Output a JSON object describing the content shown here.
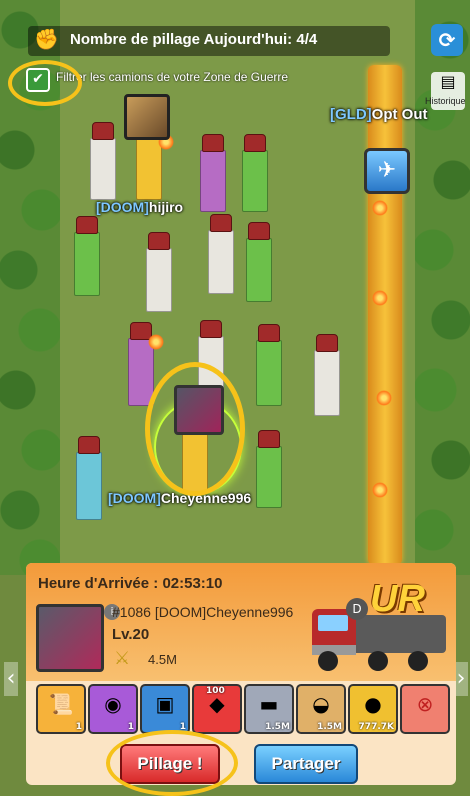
{
  "header": {
    "raid_count_label": "Nombre de pillage Aujourd'hui: 4/4",
    "history_label": "Historique"
  },
  "filter": {
    "label": "Filtrer les camions de votre Zone de Guerre",
    "checked": true
  },
  "map": {
    "players": [
      {
        "tag": "[DOOM]",
        "name": "hijiro"
      },
      {
        "tag": "[GLD]",
        "name": "Opt Out"
      },
      {
        "tag": "[DOOM]",
        "name": "Cheyenne996"
      }
    ],
    "truck_colors": {
      "white": "#e8e6df",
      "yellow": "#f2c232",
      "purple": "#b66cc4",
      "green": "#6cc04a",
      "blue": "#6cc6d8",
      "road": "#f7c23a"
    }
  },
  "panel": {
    "arrival_label": "Heure d'Arrivée : 02:53:10",
    "truck_id": "#1086 [DOOM]Cheyenne996",
    "level": "Lv.20",
    "power": "4.5M",
    "rarity": "UR",
    "rewards": [
      {
        "icon": "document-icon",
        "qty": "1",
        "color": "#f6b23a"
      },
      {
        "icon": "purple-chest-icon",
        "qty": "1",
        "color": "#a85ad8"
      },
      {
        "icon": "blue-chest-icon",
        "qty": "1",
        "color": "#3a8ad8"
      },
      {
        "icon": "red-gem-icon",
        "qty": "100",
        "color": "#e83a3a"
      },
      {
        "icon": "iron-icon",
        "qty": "1.5M",
        "color": "#a0a8b8"
      },
      {
        "icon": "bread-icon",
        "qty": "1.5M",
        "color": "#e0b068"
      },
      {
        "icon": "gold-coin-icon",
        "qty": "777.7K",
        "color": "#f0c030"
      },
      {
        "icon": "blocked-icon",
        "qty": "",
        "color": "#f08070"
      }
    ]
  },
  "buttons": {
    "raid": "Pillage !",
    "share": "Partager"
  }
}
